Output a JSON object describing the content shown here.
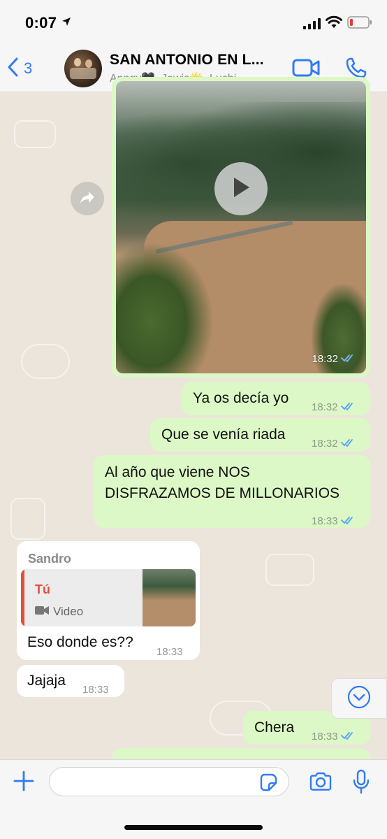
{
  "status_bar": {
    "time": "0:07",
    "icons": [
      "location-arrow-icon",
      "signal-icon",
      "wifi-icon",
      "battery-low-icon"
    ]
  },
  "header": {
    "back_count": "3",
    "title": "SAN ANTONIO EN L...",
    "subtitle": "Anngy🖤, Jowis🌟, Luchi...",
    "icons": [
      "back-chevron-icon",
      "video-call-icon",
      "phone-icon"
    ]
  },
  "messages": [
    {
      "type": "video",
      "direction": "out",
      "time": "18:32",
      "status": "read"
    },
    {
      "type": "text",
      "direction": "out",
      "text": "Ya os decía yo",
      "time": "18:32",
      "status": "read"
    },
    {
      "type": "text",
      "direction": "out",
      "text": "Que se venía riada",
      "time": "18:32",
      "status": "read"
    },
    {
      "type": "text",
      "direction": "out",
      "text_lines": [
        "Al año que viene NOS",
        "DISFRAZAMOS DE MILLONARIOS"
      ],
      "time": "18:33",
      "status": "read"
    },
    {
      "type": "reply",
      "direction": "in",
      "sender": "Sandro",
      "quote_author": "Tú",
      "quote_type": "Video",
      "text": "Eso donde es??",
      "time": "18:33"
    },
    {
      "type": "text",
      "direction": "in",
      "text": "Jajaja",
      "time": "18:33"
    },
    {
      "type": "text",
      "direction": "out",
      "text": "Chera",
      "time": "18:33",
      "status": "read"
    }
  ],
  "input": {
    "placeholder": "",
    "value": ""
  },
  "colors": {
    "accent": "#2f7bf5",
    "outgoing_bubble": "#dcf8c6",
    "incoming_bubble": "#ffffff",
    "read_ticks": "#4fa3f7",
    "reply_accent": "#e0503d",
    "wallpaper": "#ece5dc"
  }
}
